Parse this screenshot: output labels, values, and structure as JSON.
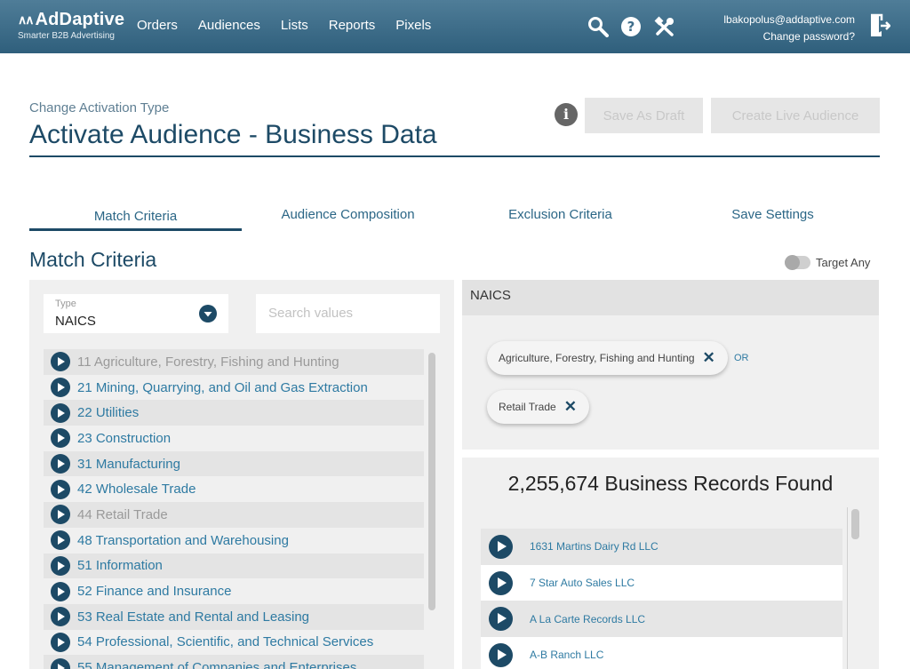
{
  "app": {
    "logo": "AdDaptive",
    "tagline": "Smarter B2B Advertising",
    "nav": [
      "Orders",
      "Audiences",
      "Lists",
      "Reports",
      "Pixels"
    ],
    "user_email": "lbakopolus@addaptive.com",
    "change_password": "Change password?"
  },
  "page": {
    "change_type_link": "Change Activation Type",
    "title": "Activate Audience - Business Data",
    "save_draft": "Save As Draft",
    "create_live": "Create Live Audience",
    "info": "i"
  },
  "tabs": [
    "Match Criteria",
    "Audience Composition",
    "Exclusion Criteria",
    "Save Settings"
  ],
  "active_tab": "Match Criteria",
  "section": {
    "title": "Match Criteria",
    "target_any_label": "Target Any",
    "target_any_on": false
  },
  "filter": {
    "type_label": "Type",
    "type_value": "NAICS",
    "search_placeholder": "Search values"
  },
  "naics_list": [
    {
      "label": "11 Agriculture, Forestry, Fishing and Hunting",
      "selected": true
    },
    {
      "label": "21 Mining, Quarrying, and Oil and Gas Extraction",
      "selected": false
    },
    {
      "label": "22 Utilities",
      "selected": false
    },
    {
      "label": "23 Construction",
      "selected": false
    },
    {
      "label": "31 Manufacturing",
      "selected": false
    },
    {
      "label": "42 Wholesale Trade",
      "selected": false
    },
    {
      "label": "44 Retail Trade",
      "selected": true
    },
    {
      "label": "48 Transportation and Warehousing",
      "selected": false
    },
    {
      "label": "51 Information",
      "selected": false
    },
    {
      "label": "52 Finance and Insurance",
      "selected": false
    },
    {
      "label": "53 Real Estate and Rental and Leasing",
      "selected": false
    },
    {
      "label": "54 Professional, Scientific, and Technical Services",
      "selected": false
    },
    {
      "label": "55 Management of Companies and Enterprises",
      "selected": false
    }
  ],
  "naics_panel": {
    "title": "NAICS",
    "chips": [
      "Agriculture, Forestry, Fishing and Hunting",
      "Retail Trade"
    ],
    "operator": "OR"
  },
  "records": {
    "count_text": "2,255,674 Business Records Found",
    "items": [
      "1631 Martins Dairy Rd LLC",
      "7 Star Auto Sales LLC",
      "A La Carte Records LLC",
      "A-B Ranch LLC"
    ]
  },
  "colors": {
    "header": "#3f6e8b",
    "primary": "#1d4a66",
    "link": "#2e7aa2"
  }
}
